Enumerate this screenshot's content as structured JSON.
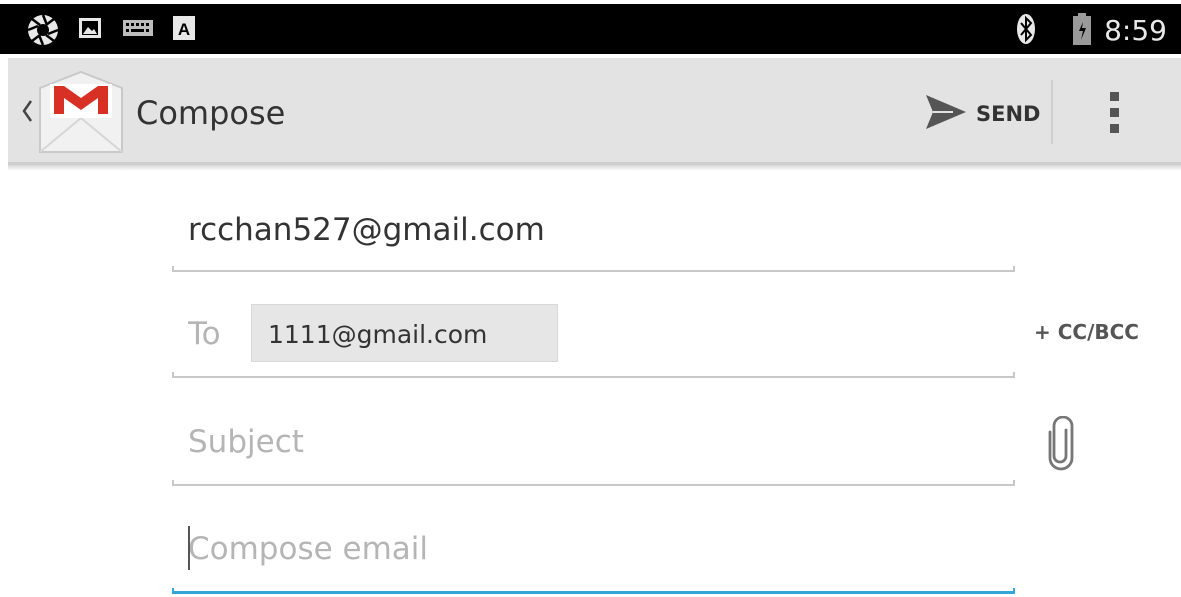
{
  "status_bar": {
    "time": "8:59",
    "icons": [
      "aperture-icon",
      "image-icon",
      "keyboard-icon",
      "text-input-icon",
      "bluetooth-icon",
      "battery-icon"
    ]
  },
  "action_bar": {
    "title": "Compose",
    "send_label": "SEND",
    "logo": "gmail-logo-icon"
  },
  "form": {
    "from_account": "rcchan527@gmail.com",
    "to_label": "To",
    "recipients": [
      "1111@gmail.com"
    ],
    "cc_bcc_label": "+ CC/BCC",
    "subject_placeholder": "Subject",
    "body_placeholder": "Compose email"
  },
  "colors": {
    "status_bar_bg": "#000000",
    "action_bar_bg": "#e3e3e3",
    "gmail_red": "#d93025",
    "focus_underline": "#33a6d8",
    "placeholder_text": "#b5b5b5"
  }
}
